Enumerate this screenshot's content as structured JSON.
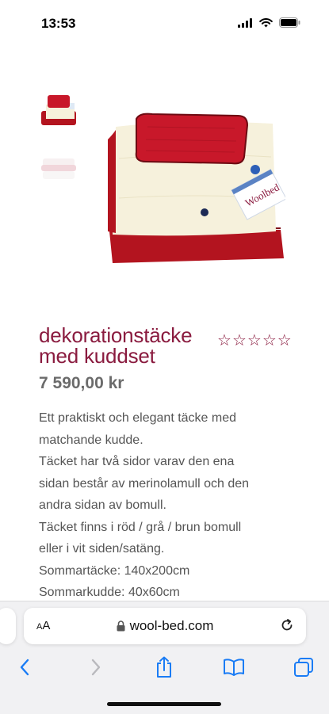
{
  "status_bar": {
    "time": "13:53"
  },
  "gallery": {
    "thumbnails": [
      "red-blanket-pillow-thumb",
      "white-blanket-stack-thumb"
    ],
    "main_image_logo": "Woolbed"
  },
  "product": {
    "title_line1": "dekorationstäcke",
    "title_line2": "med kuddset",
    "rating_stars": [
      "☆",
      "☆",
      "☆",
      "☆",
      "☆"
    ],
    "price": "7 590,00 kr",
    "description_lines": [
      "Ett praktiskt och elegant täcke med",
      "matchande kudde.",
      "Täcket har två sidor varav den ena",
      "sidan består av merinolamull och den",
      "andra sidan av bomull.",
      "Täcket finns i röd / grå / brun bomull",
      "eller i vit siden/satäng.",
      "Sommartäcke: 140x200cm",
      "Sommarkudde: 40x60cm"
    ]
  },
  "browser": {
    "aa_small": "A",
    "aa_big": "A",
    "url": "wool-bed.com",
    "icons": [
      "lock-icon",
      "reload-icon",
      "back-icon",
      "forward-icon",
      "share-icon",
      "bookmarks-icon",
      "tabs-icon"
    ]
  },
  "colors": {
    "brand": "#8a1b3f",
    "accent_blue": "#1a7cf5",
    "fabric_red": "#b3141f",
    "wool_cream": "#f6f1dc"
  }
}
